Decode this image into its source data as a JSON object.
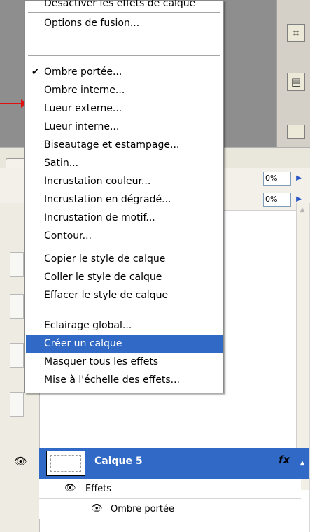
{
  "background": {
    "percent_1": "0%",
    "percent_2": "0%",
    "arrow_glyph": "▶"
  },
  "menu": {
    "items": [
      {
        "label": "Désactiver les effets de calque"
      },
      {
        "label": "Options de fusion..."
      },
      {
        "label": "Ombre portée...",
        "checked": true
      },
      {
        "label": "Ombre interne..."
      },
      {
        "label": "Lueur externe..."
      },
      {
        "label": "Lueur interne..."
      },
      {
        "label": "Biseautage et estampage..."
      },
      {
        "label": "Satin..."
      },
      {
        "label": "Incrustation couleur..."
      },
      {
        "label": "Incrustation en dégradé..."
      },
      {
        "label": "Incrustation de motif..."
      },
      {
        "label": "Contour..."
      },
      {
        "label": "Copier le style de calque"
      },
      {
        "label": "Coller le style de calque"
      },
      {
        "label": "Effacer le style de calque"
      },
      {
        "label": "Eclairage global..."
      },
      {
        "label": "Créer un calque",
        "highlighted": true
      },
      {
        "label": "Masquer tous les effets"
      },
      {
        "label": "Mise à l'échelle des effets..."
      }
    ],
    "check_glyph": "✔"
  },
  "layers": {
    "selected_layer": {
      "name": "Calque 5",
      "fx": "fx"
    },
    "effects_label": "Effets",
    "effect_items": [
      "Ombre portée"
    ],
    "eye_glyph": "👁"
  },
  "colors": {
    "highlight": "#3169c6",
    "arrow": "#e01010"
  }
}
